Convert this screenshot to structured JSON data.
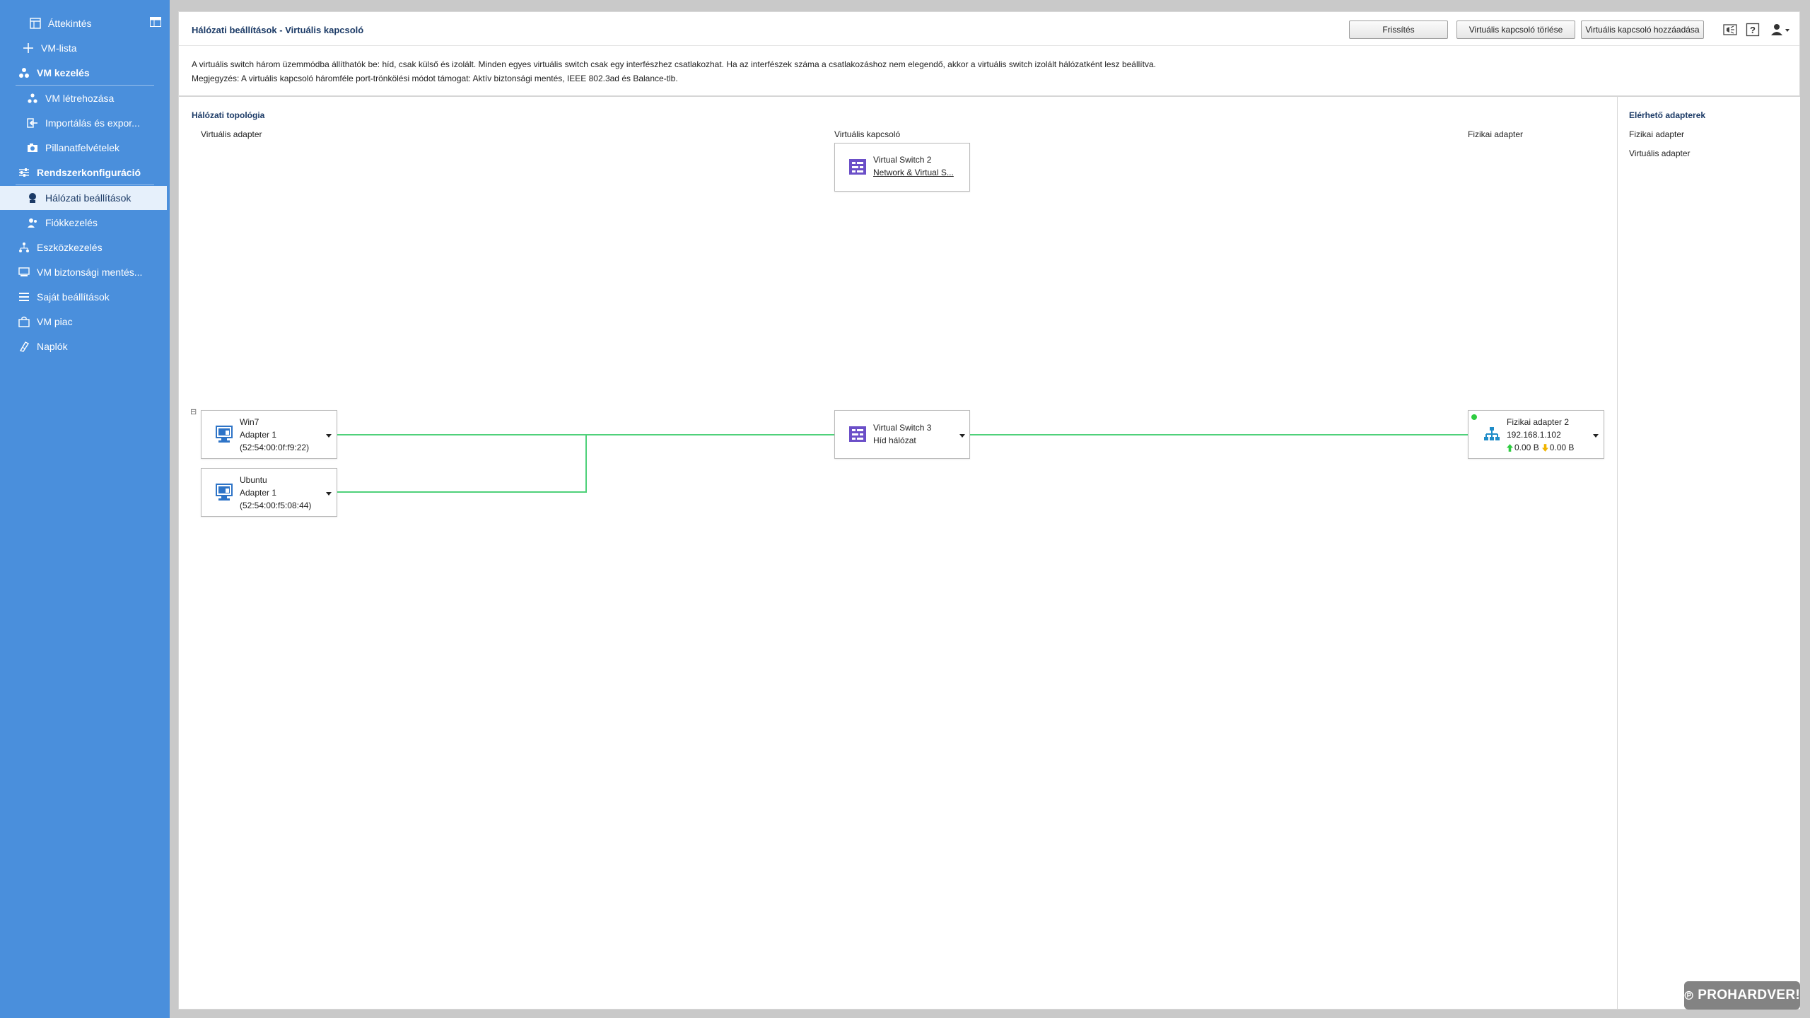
{
  "sidebar": {
    "items": [
      {
        "label": "Áttekintés",
        "icon": "dashboard-icon"
      },
      {
        "label": "VM-lista",
        "icon": "plus-icon"
      },
      {
        "label": "VM kezelés",
        "icon": "vm-group-icon"
      },
      {
        "label": "VM létrehozása",
        "icon": "vm-create-icon"
      },
      {
        "label": "Importálás és expor...",
        "icon": "import-export-icon"
      },
      {
        "label": "Pillanatfelvételek",
        "icon": "snapshot-icon"
      },
      {
        "label": "Rendszerkonfiguráció",
        "icon": "sliders-icon"
      },
      {
        "label": "Hálózati beállítások",
        "icon": "network-settings-icon"
      },
      {
        "label": "Fiókkezelés",
        "icon": "account-icon"
      },
      {
        "label": "Eszközkezelés",
        "icon": "device-icon"
      },
      {
        "label": "VM biztonsági mentés...",
        "icon": "backup-icon"
      },
      {
        "label": "Saját beállítások",
        "icon": "list-icon"
      },
      {
        "label": "VM piac",
        "icon": "market-icon"
      },
      {
        "label": "Naplók",
        "icon": "log-icon"
      }
    ]
  },
  "header": {
    "title": "Hálózati beállítások - Virtuális kapcsoló",
    "buttons": {
      "refresh": "Frissítés",
      "delete_switch": "Virtuális kapcsoló törlése",
      "add_switch": "Virtuális kapcsoló hozzáadása"
    }
  },
  "description": {
    "line1": "A virtuális switch három üzemmódba állíthatók be: híd, csak külső és izolált. Minden egyes virtuális switch csak egy interfészhez csatlakozhat. Ha az interfészek száma a csatlakozáshoz nem elegendő, akkor a virtuális switch izolált hálózatként lesz beállítva.",
    "line2": "Megjegyzés: A virtuális kapcsoló háromféle port-trönkölési módot támogat: Aktív biztonsági mentés, IEEE 802.3ad és Balance-tlb."
  },
  "topology": {
    "title": "Hálózati topológia",
    "columns": {
      "virtual_adapter": "Virtuális adapter",
      "virtual_switch": "Virtuális kapcsoló",
      "physical_adapter": "Fizikai adapter"
    },
    "switch2": {
      "name": "Virtual Switch 2",
      "link": "Network & Virtual S..."
    },
    "switch3": {
      "name": "Virtual Switch 3",
      "mode": "Híd hálózat"
    },
    "vm1": {
      "name": "Win7",
      "adapter": "Adapter 1",
      "mac": "(52:54:00:0f:f9:22)"
    },
    "vm2": {
      "name": "Ubuntu",
      "adapter": "Adapter 1",
      "mac": "(52:54:00:f5:08:44)"
    },
    "physical": {
      "name": "Fizikai adapter 2",
      "ip": "192.168.1.102",
      "upload": "0.00 B",
      "download": "0.00 B",
      "status_color": "#2ecc40"
    },
    "collapse_glyph": "⊟"
  },
  "right_panel": {
    "title": "Elérhető adapterek",
    "items": [
      "Fizikai adapter",
      "Virtuális adapter"
    ]
  },
  "watermark": "PROHARDVER!",
  "colors": {
    "sidebar": "#4a8fdc",
    "active_item_bg": "#e6f0fb",
    "link_line": "#4fd17a",
    "switch_icon": "#6b4fc8",
    "vm_icon": "#2e74c7",
    "physical_icon": "#1f8cc8"
  }
}
